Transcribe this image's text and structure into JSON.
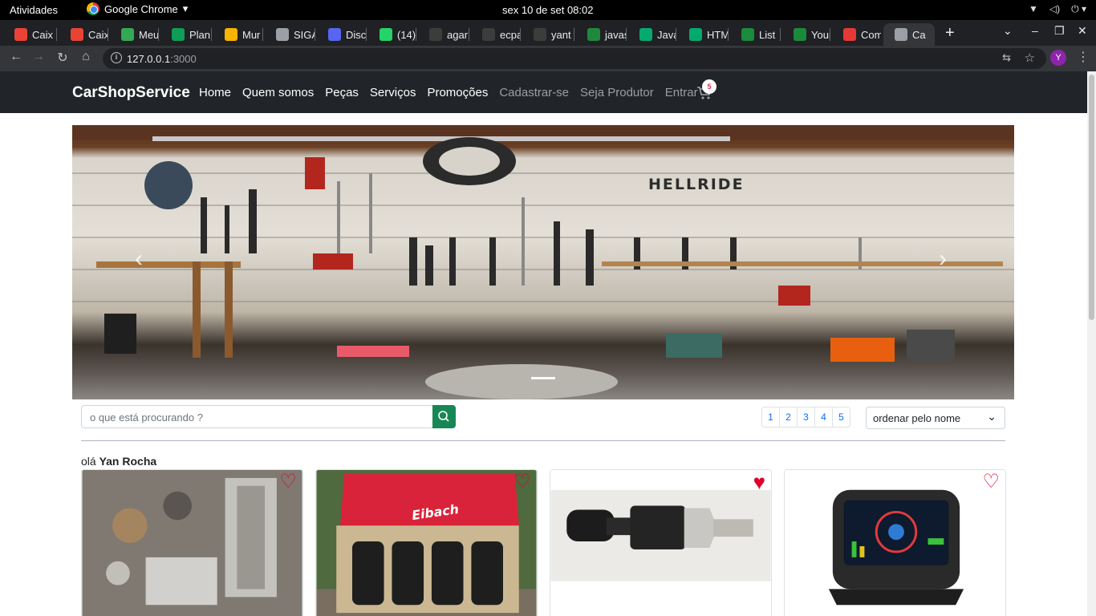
{
  "system_bar": {
    "activities": "Atividades",
    "app_name": "Google Chrome",
    "clock": "sex 10 de set  08:02"
  },
  "tabs": [
    {
      "label": "Caix",
      "icon": "gmail-icon",
      "color": "#ea4335"
    },
    {
      "label": "Caix",
      "icon": "gmail-icon",
      "color": "#ea4335"
    },
    {
      "label": "Meu",
      "icon": "drive-icon",
      "color": "#34a853"
    },
    {
      "label": "Plan",
      "icon": "sheets-icon",
      "color": "#0f9d58"
    },
    {
      "label": "Mur",
      "icon": "classroom-icon",
      "color": "#f4b400"
    },
    {
      "label": "SIGA",
      "icon": "globe-icon",
      "color": "#9aa0a6"
    },
    {
      "label": "Disc",
      "icon": "discord-icon",
      "color": "#5865f2"
    },
    {
      "label": "(14)",
      "icon": "whatsapp-icon",
      "color": "#25d366"
    },
    {
      "label": "agar",
      "icon": "github-icon",
      "color": "#3c3c3c"
    },
    {
      "label": "ecpa",
      "icon": "github-icon",
      "color": "#3c3c3c"
    },
    {
      "label": "yant",
      "icon": "github-icon",
      "color": "#3c3c3c"
    },
    {
      "label": "javas",
      "icon": "codepen-icon",
      "color": "#1f883d"
    },
    {
      "label": "Java",
      "icon": "w3schools-icon",
      "color": "#04aa6d"
    },
    {
      "label": "HTM",
      "icon": "w3schools-icon",
      "color": "#04aa6d"
    },
    {
      "label": "List",
      "icon": "leaf-icon",
      "color": "#1b8a3c"
    },
    {
      "label": "Your",
      "icon": "leaf-icon",
      "color": "#1b8a3c"
    },
    {
      "label": "Com",
      "icon": "qa-icon",
      "color": "#e53935"
    },
    {
      "label": "Ca",
      "icon": "globe-icon",
      "color": "#9aa0a6",
      "active": true
    }
  ],
  "toolbar": {
    "url_host": "127.0.0.1",
    "url_port": ":3000",
    "profile_initial": "Y"
  },
  "site": {
    "brand": "CarShopService",
    "nav": [
      {
        "label": "Home",
        "muted": false
      },
      {
        "label": "Quem somos",
        "muted": false
      },
      {
        "label": "Peças",
        "muted": false
      },
      {
        "label": "Serviços",
        "muted": false
      },
      {
        "label": "Promoções",
        "muted": false
      },
      {
        "label": "Cadastrar-se",
        "muted": true
      },
      {
        "label": "Seja Produtor",
        "muted": true
      },
      {
        "label": "Entrar",
        "muted": true
      }
    ],
    "cart_count": "5",
    "hero_sign": "HELLRIDE"
  },
  "search": {
    "placeholder": "o que está procurando ?"
  },
  "pagination": [
    "1",
    "2",
    "3",
    "4",
    "5"
  ],
  "sort": {
    "selected": "ordenar pelo nome"
  },
  "greeting": {
    "prefix": "olá",
    "user_name": "Yan Rocha"
  },
  "products": [
    {
      "name": "engine-parts",
      "favorited": false
    },
    {
      "name": "eibach-springs-box",
      "favorited": false
    },
    {
      "name": "pressure-sensor",
      "favorited": true
    },
    {
      "name": "digital-dash-display",
      "favorited": false
    }
  ],
  "colors": {
    "navbar_bg": "#212529",
    "search_button": "#198754",
    "link_blue": "#0d6efd",
    "heart_red": "#e0002a"
  }
}
